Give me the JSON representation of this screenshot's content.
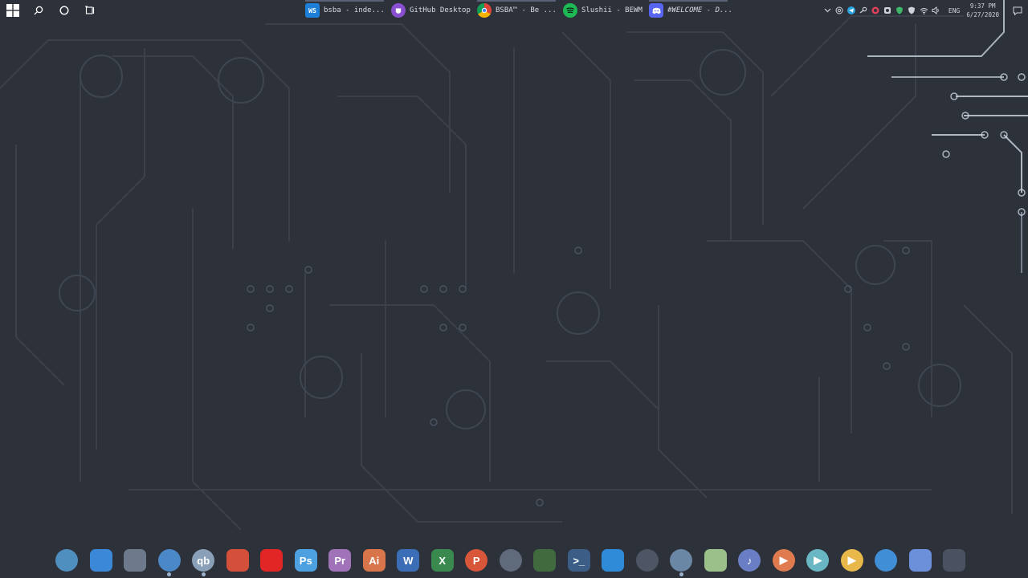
{
  "taskbar": {
    "start_icon": "windows-logo-icon",
    "search_icon": "search-icon",
    "cortana_icon": "cortana-circle-icon",
    "taskview_icon": "task-view-icon",
    "items": [
      {
        "label": "bsba - inde...",
        "icon": "webstorm-icon",
        "icon_text": "WS",
        "color": "#1d7fd8"
      },
      {
        "label": "GitHub Desktop",
        "icon": "github-desktop-icon",
        "icon_text": "",
        "color": "#8a4fd1"
      },
      {
        "label": "BSBA™ - Be ...",
        "icon": "chrome-icon",
        "icon_text": "",
        "color": "#4285f4"
      },
      {
        "label": "Slushii - BEWM",
        "icon": "spotify-icon",
        "icon_text": "",
        "color": "#1db954"
      },
      {
        "label": "#WELCOME - D...",
        "icon": "discord-icon",
        "icon_text": "",
        "color": "#5865f2"
      }
    ],
    "tray": {
      "language": "ENG",
      "time": "9:37 PM",
      "date": "6/27/2020",
      "icons": [
        "chevron-up-icon",
        "at-icon",
        "telegram-icon",
        "steam-icon",
        "app-icon",
        "settings-icon",
        "shield-icon",
        "wifi-icon",
        "volume-icon"
      ]
    }
  },
  "dock": {
    "items": [
      {
        "name": "browser",
        "icon": "globe-icon",
        "color": "#4e8fbf",
        "text": "",
        "round": true
      },
      {
        "name": "finder",
        "icon": "finder-icon",
        "color": "#3b87d8",
        "text": "",
        "round": false
      },
      {
        "name": "files",
        "icon": "folder-icon",
        "color": "#6c7a8c",
        "text": "",
        "round": false
      },
      {
        "name": "search",
        "icon": "search-icon",
        "color": "#4a88c7",
        "text": "",
        "round": true
      },
      {
        "name": "qbittorrent",
        "icon": "qbittorrent-icon",
        "color": "#8aa0b8",
        "text": "qb",
        "round": true
      },
      {
        "name": "apps",
        "icon": "grid-icon",
        "color": "#d4503a",
        "text": "",
        "round": false
      },
      {
        "name": "acrobat",
        "icon": "acrobat-icon",
        "color": "#e22626",
        "text": "",
        "round": false
      },
      {
        "name": "photoshop",
        "icon": "photoshop-icon",
        "color": "#4ea1e0",
        "text": "Ps",
        "round": false
      },
      {
        "name": "premiere",
        "icon": "premiere-icon",
        "color": "#a073b8",
        "text": "Pr",
        "round": false
      },
      {
        "name": "illustrator",
        "icon": "illustrator-icon",
        "color": "#d8754a",
        "text": "Ai",
        "round": false
      },
      {
        "name": "word",
        "icon": "word-icon",
        "color": "#3b6eb6",
        "text": "W",
        "round": false
      },
      {
        "name": "excel",
        "icon": "excel-icon",
        "color": "#3a8a4f",
        "text": "X",
        "round": false
      },
      {
        "name": "powerpoint",
        "icon": "powerpoint-icon",
        "color": "#d8573a",
        "text": "P",
        "round": true
      },
      {
        "name": "settings",
        "icon": "gear-icon",
        "color": "#5f6a7b",
        "text": "",
        "round": true
      },
      {
        "name": "craft",
        "icon": "craft-icon",
        "color": "#3f6b3f",
        "text": "",
        "round": false
      },
      {
        "name": "terminal",
        "icon": "terminal-icon",
        "color": "#3b5d86",
        "text": ">_",
        "round": false
      },
      {
        "name": "vscode",
        "icon": "vscode-icon",
        "color": "#2f8ad8",
        "text": "",
        "round": false
      },
      {
        "name": "github",
        "icon": "github-icon",
        "color": "#4e5564",
        "text": "",
        "round": true
      },
      {
        "name": "steam",
        "icon": "steam-icon",
        "color": "#6a87a5",
        "text": "",
        "round": true
      },
      {
        "name": "ghost",
        "icon": "ghost-icon",
        "color": "#9bc08a",
        "text": "",
        "round": false
      },
      {
        "name": "music",
        "icon": "music-note-icon",
        "color": "#6a7ec6",
        "text": "♪",
        "round": true
      },
      {
        "name": "player-orange",
        "icon": "play-icon",
        "color": "#e07a4f",
        "text": "▶",
        "round": true
      },
      {
        "name": "player-teal",
        "icon": "play-icon",
        "color": "#6ab7c4",
        "text": "▶",
        "round": true
      },
      {
        "name": "player-yellow",
        "icon": "play-icon",
        "color": "#e8b84a",
        "text": "▶",
        "round": true
      },
      {
        "name": "telegram",
        "icon": "telegram-icon",
        "color": "#3f8ed6",
        "text": "",
        "round": true
      },
      {
        "name": "discord",
        "icon": "discord-icon",
        "color": "#6b8fd8",
        "text": "",
        "round": false
      },
      {
        "name": "trash",
        "icon": "trash-icon",
        "color": "#4a5160",
        "text": "",
        "round": false
      }
    ],
    "running": [
      "search",
      "qbittorrent",
      "steam"
    ]
  }
}
